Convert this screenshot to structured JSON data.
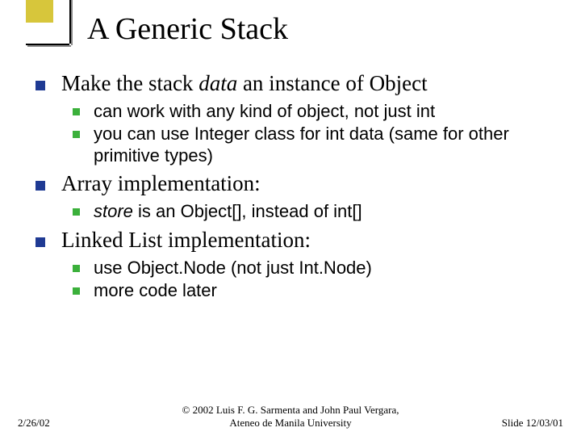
{
  "title": "A Generic Stack",
  "bullets": {
    "b1": {
      "pre": "Make the stack ",
      "em": "data",
      "post": " an instance of Object"
    },
    "b1a": "can work with any kind of object, not just int",
    "b1b": "you can use Integer class for int data (same for other primitive types)",
    "b2": "Array implementation:",
    "b2a": {
      "pre": "",
      "em": "store",
      "post": " is an Object[], instead of int[]"
    },
    "b3": "Linked List implementation:",
    "b3a": "use Object.Node (not just Int.Node)",
    "b3b": "more code later"
  },
  "footer": {
    "date": "2/26/02",
    "copyright_line1": "© 2002 Luis F. G. Sarmenta and John Paul Vergara,",
    "copyright_line2": "Ateneo de Manila University",
    "slide": "Slide 12/03/01"
  }
}
